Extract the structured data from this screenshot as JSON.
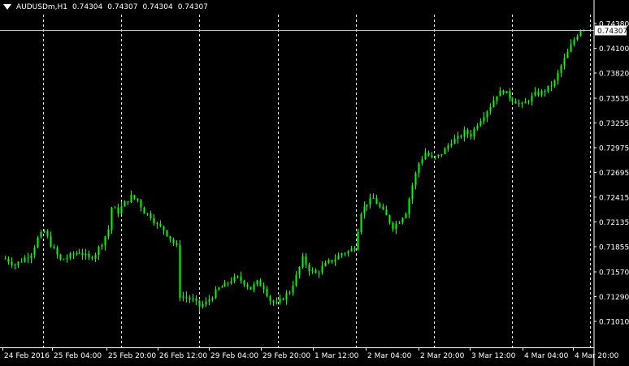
{
  "header": {
    "symbol": "AUDUSDm,H1",
    "open": "0.74304",
    "high": "0.74307",
    "low": "0.74304",
    "close": "0.74307"
  },
  "current_price_label": "0.74307",
  "colors": {
    "background": "#000000",
    "candle": "#00ff00",
    "grid": "#ffffff",
    "axis_text": "#ffffff",
    "price_line": "#c0c0c0"
  },
  "chart_data": {
    "type": "candlestick",
    "symbol": "AUDUSDm",
    "timeframe": "H1",
    "grid": true,
    "grid_style": "vertical dashed",
    "current_price": 0.74307,
    "ylim": [
      0.7101,
      0.7438
    ],
    "yticks": [
      0.7438,
      0.741,
      0.7382,
      0.73535,
      0.73255,
      0.72975,
      0.72695,
      0.72415,
      0.72135,
      0.71855,
      0.7157,
      0.7129,
      0.7101
    ],
    "ytick_labels": [
      "0.74380",
      "0.74100",
      "0.73820",
      "0.73535",
      "0.73255",
      "0.72975",
      "0.72695",
      "0.72415",
      "0.72135",
      "0.71855",
      "0.71570",
      "0.71290",
      "0.71010"
    ],
    "xtick_labels": [
      "24 Feb 2016",
      "25 Feb 04:00",
      "25 Feb 20:00",
      "26 Feb 12:00",
      "29 Feb 04:00",
      "29 Feb 20:00",
      "1 Mar 12:00",
      "2 Mar 04:00",
      "2 Mar 20:00",
      "3 Mar 12:00",
      "4 Mar 04:00",
      "4 Mar 20:00"
    ],
    "close_path": [
      [
        0,
        0.7172
      ],
      [
        3,
        0.7165
      ],
      [
        5,
        0.717
      ],
      [
        8,
        0.7178
      ],
      [
        10,
        0.7195
      ],
      [
        12,
        0.7203
      ],
      [
        14,
        0.7188
      ],
      [
        17,
        0.717
      ],
      [
        20,
        0.7175
      ],
      [
        23,
        0.718
      ],
      [
        26,
        0.7172
      ],
      [
        28,
        0.7178
      ],
      [
        30,
        0.719
      ],
      [
        32,
        0.7205
      ],
      [
        33,
        0.723
      ],
      [
        35,
        0.7225
      ],
      [
        37,
        0.7235
      ],
      [
        39,
        0.7242
      ],
      [
        41,
        0.7238
      ],
      [
        43,
        0.7225
      ],
      [
        45,
        0.722
      ],
      [
        47,
        0.721
      ],
      [
        49,
        0.7205
      ],
      [
        51,
        0.7195
      ],
      [
        53,
        0.7185
      ],
      [
        54,
        0.713
      ],
      [
        56,
        0.7128
      ],
      [
        58,
        0.7125
      ],
      [
        60,
        0.7118
      ],
      [
        62,
        0.7122
      ],
      [
        64,
        0.713
      ],
      [
        66,
        0.7138
      ],
      [
        68,
        0.7142
      ],
      [
        70,
        0.7148
      ],
      [
        72,
        0.715
      ],
      [
        74,
        0.7145
      ],
      [
        76,
        0.7138
      ],
      [
        78,
        0.7145
      ],
      [
        80,
        0.714
      ],
      [
        82,
        0.7125
      ],
      [
        84,
        0.712
      ],
      [
        86,
        0.7128
      ],
      [
        88,
        0.7135
      ],
      [
        90,
        0.7152
      ],
      [
        92,
        0.7172
      ],
      [
        94,
        0.716
      ],
      [
        96,
        0.7155
      ],
      [
        98,
        0.7162
      ],
      [
        100,
        0.7168
      ],
      [
        102,
        0.7172
      ],
      [
        104,
        0.7178
      ],
      [
        106,
        0.718
      ],
      [
        108,
        0.7185
      ],
      [
        110,
        0.7225
      ],
      [
        112,
        0.7235
      ],
      [
        114,
        0.724
      ],
      [
        116,
        0.723
      ],
      [
        118,
        0.722
      ],
      [
        120,
        0.7208
      ],
      [
        122,
        0.7215
      ],
      [
        124,
        0.7225
      ],
      [
        126,
        0.7255
      ],
      [
        128,
        0.728
      ],
      [
        130,
        0.7292
      ],
      [
        132,
        0.7285
      ],
      [
        134,
        0.7288
      ],
      [
        136,
        0.7295
      ],
      [
        138,
        0.7305
      ],
      [
        140,
        0.7308
      ],
      [
        142,
        0.7315
      ],
      [
        144,
        0.7312
      ],
      [
        146,
        0.7325
      ],
      [
        148,
        0.7335
      ],
      [
        150,
        0.7345
      ],
      [
        152,
        0.7358
      ],
      [
        154,
        0.7362
      ],
      [
        156,
        0.7355
      ],
      [
        158,
        0.735
      ],
      [
        160,
        0.7345
      ],
      [
        162,
        0.7352
      ],
      [
        164,
        0.7358
      ],
      [
        166,
        0.736
      ],
      [
        168,
        0.7365
      ],
      [
        170,
        0.7372
      ],
      [
        172,
        0.739
      ],
      [
        174,
        0.7405
      ],
      [
        176,
        0.742
      ],
      [
        178,
        0.7432
      ],
      [
        179,
        0.74307
      ]
    ],
    "bar_count": 180
  }
}
